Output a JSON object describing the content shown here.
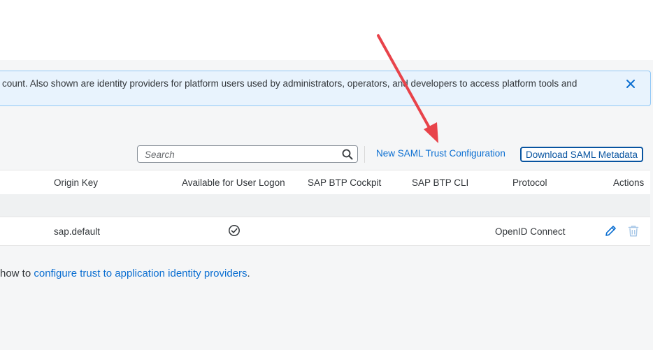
{
  "info_banner": {
    "text": "count. Also shown are identity providers for platform users used by administrators, operators, and developers to access platform tools and"
  },
  "toolbar": {
    "search_placeholder": "Search",
    "new_saml_label": "New SAML Trust Configuration",
    "download_label": "Download SAML Metadata"
  },
  "table": {
    "columns": [
      "Origin Key",
      "Available for User Logon",
      "SAP BTP Cockpit",
      "SAP BTP CLI",
      "Protocol",
      "Actions"
    ],
    "rows": [
      {
        "origin_key": "sap.default",
        "available_for_user_logon": "checked",
        "sap_btp_cockpit": "",
        "sap_btp_cli": "",
        "protocol": "OpenID Connect"
      }
    ]
  },
  "footer": {
    "prefix": "how to ",
    "link_text": "configure trust to application identity providers",
    "suffix": "."
  },
  "colors": {
    "link": "#0a6ed1",
    "annotation_arrow": "#e8434a",
    "info_background": "#e8f3fd"
  },
  "icons": [
    "close-icon",
    "search-icon",
    "check-circle-icon",
    "edit-icon",
    "delete-icon"
  ]
}
